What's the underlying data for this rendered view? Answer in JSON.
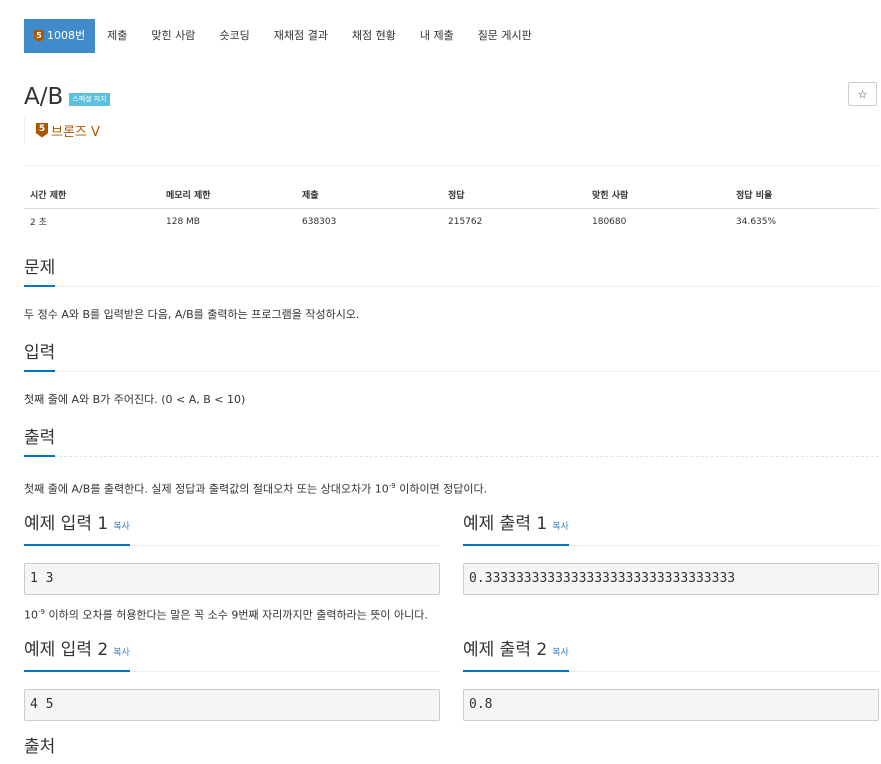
{
  "nav": {
    "tabs": [
      {
        "label": "1008번",
        "active": true,
        "tier_num": "5"
      },
      {
        "label": "제출"
      },
      {
        "label": "맞힌 사람"
      },
      {
        "label": "숏코딩"
      },
      {
        "label": "재채점 결과"
      },
      {
        "label": "채점 현황"
      },
      {
        "label": "내 제출"
      },
      {
        "label": "질문 게시판"
      }
    ]
  },
  "problem": {
    "title": "A/B",
    "label": "스페셜 저지",
    "star": "☆",
    "tier_num": "5",
    "tier": "브론즈 V",
    "tier_color": "#ad5600"
  },
  "stats": {
    "headers": [
      "시간 제한",
      "메모리 제한",
      "제출",
      "정답",
      "맞힌 사람",
      "정답 비율"
    ],
    "values": [
      "2 초",
      "128 MB",
      "638303",
      "215762",
      "180680",
      "34.635%"
    ]
  },
  "sections": {
    "description_title": "문제",
    "description": "두 정수 A와 B를 입력받은 다음, A/B를 출력하는 프로그램을 작성하시오.",
    "input_title": "입력",
    "input": "첫째 줄에 A와 B가 주어진다. (0 < A, B < 10)",
    "output_title": "출력",
    "output_pre": "첫째 줄에 A/B를 출력한다. 실제 정답과 출력값의 절대오차 또는 상대오차가 10",
    "output_sup": "-9",
    "output_post": " 이하이면 정답이다.",
    "source_title": "출처"
  },
  "samples": {
    "copy_label": "복사",
    "input1_title": "예제 입력 1",
    "output1_title": "예제 출력 1",
    "input1": "1 3",
    "output1": "0.33333333333333333333333333333333",
    "note_pre": "10",
    "note_sup": "-9",
    "note_post": " 이하의 오차를 허용한다는 말은 꼭 소수 9번째 자리까지만 출력하라는 뜻이 아니다.",
    "input2_title": "예제 입력 2",
    "output2_title": "예제 출력 2",
    "input2": "4 5",
    "output2": "0.8"
  },
  "colors": {
    "active_tab": "#428bca",
    "section_underline": "#0076c0",
    "spj_badge": "#5bc0de"
  }
}
